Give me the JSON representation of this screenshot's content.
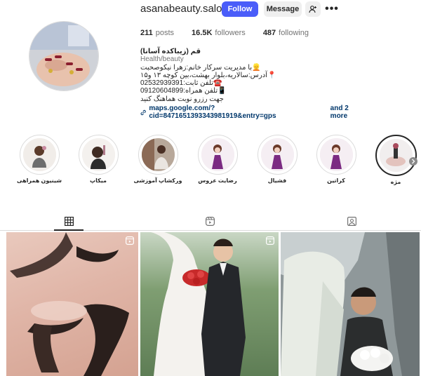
{
  "profile": {
    "username": "asanabeauty.salon",
    "follow_label": "Follow",
    "message_label": "Message",
    "more_label": "•••"
  },
  "stats": {
    "posts_count": "211",
    "posts_label": "posts",
    "followers_count": "16.5K",
    "followers_label": "followers",
    "following_count": "487",
    "following_label": "following"
  },
  "bio": {
    "name": "(زیباکده آسانا) قم",
    "category": "Health/beauty",
    "lines": [
      "با مدیریت سرکار خانم:زهرا نیکوصحبت👱",
      "آدرس:سالاریه،بلوار بهشت،بین کوچه ۱۳ و۱۵📍",
      "تلفن ثابت:02532939391☎️",
      "تلفن همراه:09120604899📱",
      "جهت رزرو نوبت هماهنگ کنید"
    ],
    "link_text": "maps.google.com/?cid=8471651393343981919&entry=gps",
    "link_more": "and 2 more"
  },
  "highlights": [
    {
      "label": "شینیون همراهی"
    },
    {
      "label": "میکاپ"
    },
    {
      "label": "ورکشاپ آموزشی"
    },
    {
      "label": "رضایت عروس"
    },
    {
      "label": "فشیال"
    },
    {
      "label": "کراتین"
    },
    {
      "label": "مژه"
    }
  ],
  "tabs": [
    {
      "icon": "grid-icon"
    },
    {
      "icon": "reels-icon"
    },
    {
      "icon": "tagged-icon"
    }
  ],
  "colors": {
    "follow_button": "#4a5df9",
    "link": "#00376b",
    "text": "#262626",
    "muted": "#737373"
  }
}
